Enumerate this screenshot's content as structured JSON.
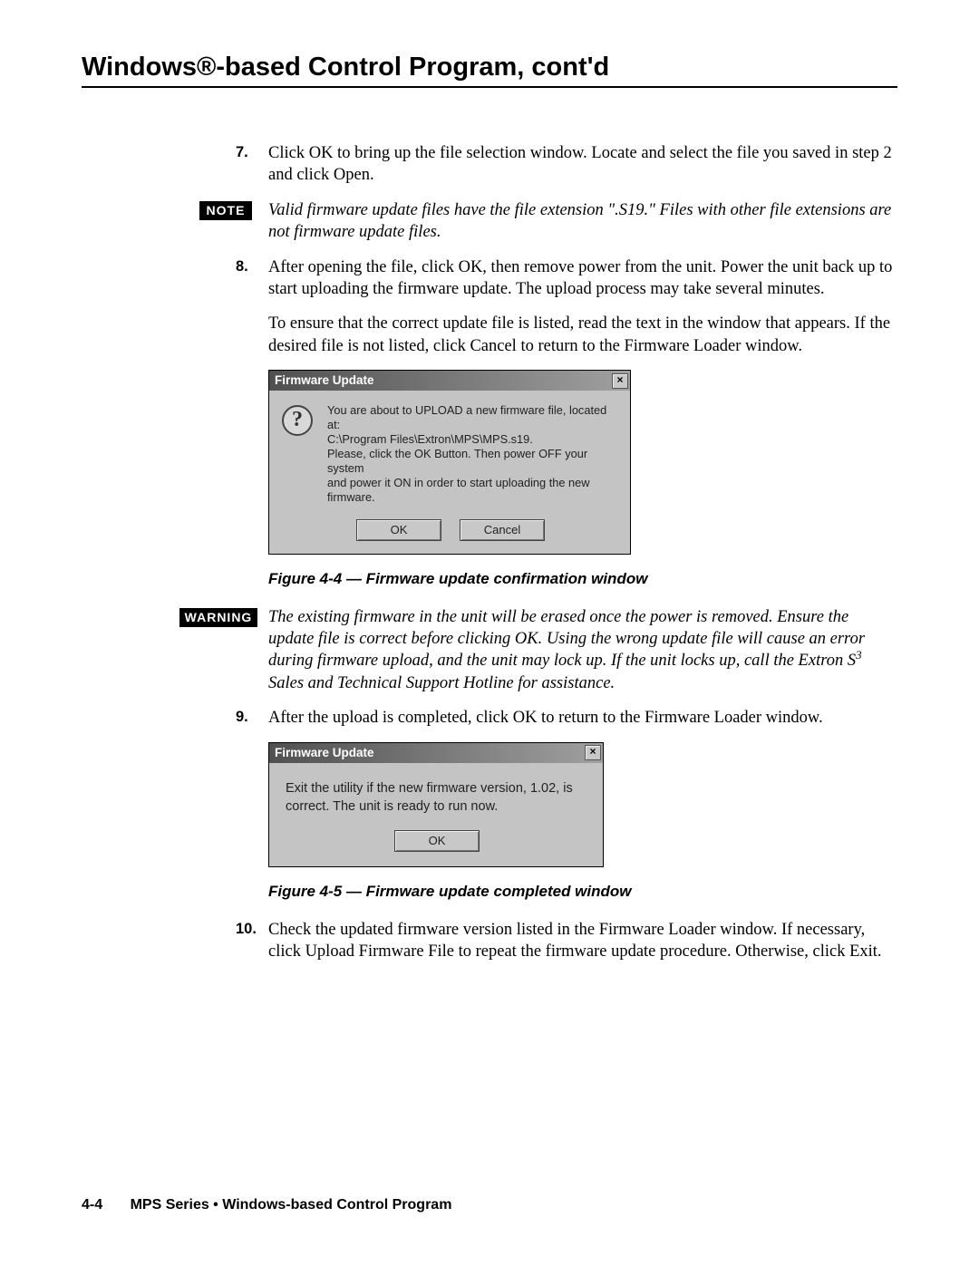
{
  "header": {
    "title": "Windows®-based Control Program, cont'd"
  },
  "steps": {
    "s7": {
      "num": "7.",
      "text": "Click OK to bring up the file selection window.  Locate and select the file you saved in step 2 and click Open."
    },
    "s8": {
      "num": "8.",
      "p1": "After opening the file, click OK, then remove power from the unit.  Power the unit back up to start uploading the firmware update.  The upload process may take several minutes.",
      "p2": "To ensure that the correct update file is listed, read the text in the window that appears.  If the desired file is not listed, click Cancel to return to the Firmware Loader window."
    },
    "s9": {
      "num": "9.",
      "text": "After the upload is completed, click OK to return to the Firmware Loader window."
    },
    "s10": {
      "num": "10.",
      "text": "Check the updated firmware version listed in the Firmware Loader window.  If necessary, click Upload Firmware File to repeat the firmware update procedure.  Otherwise, click Exit."
    }
  },
  "note": {
    "label": "NOTE",
    "text": "Valid firmware update files have the file extension \".S19.\"  Files with other file extensions are not firmware update files."
  },
  "warning": {
    "label": "WARNING",
    "text_html": "The existing firmware in the unit will be erased once the power is removed.  Ensure the update file is correct before clicking OK.   Using the wrong update file will cause an error during firmware upload, and the unit may lock up.  If the unit locks up, call the Extron S<sup>3</sup> Sales and Technical Support Hotline for assistance."
  },
  "dialog1": {
    "title": "Firmware Update",
    "close": "×",
    "icon_char": "?",
    "message": "You are about to UPLOAD a new firmware file, located at:\nC:\\Program Files\\Extron\\MPS\\MPS.s19.\nPlease, click the OK Button. Then power OFF your system\nand power it ON in order to start uploading the new firmware.",
    "ok": "OK",
    "cancel": "Cancel"
  },
  "dialog2": {
    "title": "Firmware Update",
    "close": "×",
    "message": "Exit the utility if the new firmware version,  1.02, is correct. The unit is ready to run now.",
    "ok": "OK"
  },
  "captions": {
    "fig44": "Figure 4-4 — Firmware update confirmation window",
    "fig45": "Figure 4-5 — Firmware update completed window"
  },
  "footer": {
    "page": "4-4",
    "text": "MPS Series • Windows-based Control Program"
  }
}
